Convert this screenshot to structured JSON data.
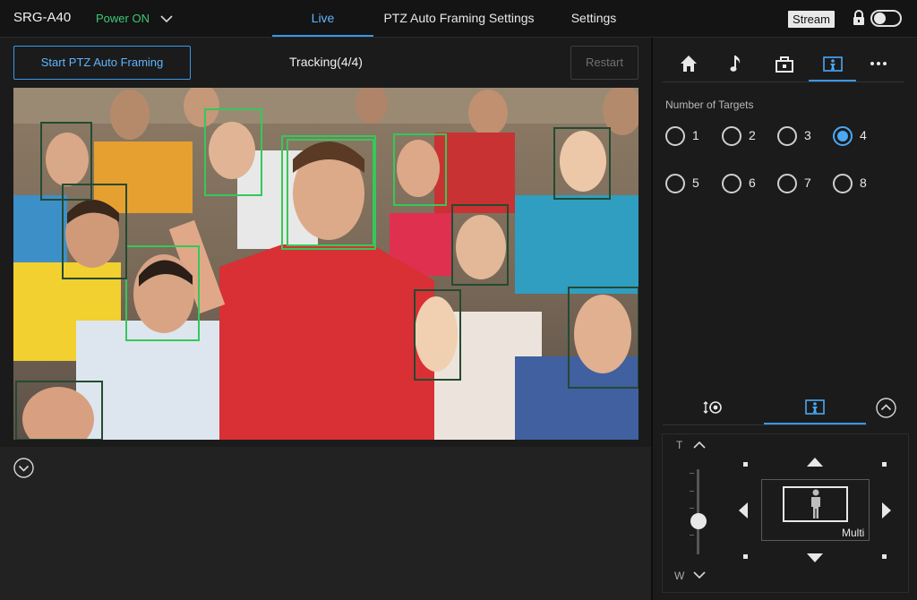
{
  "header": {
    "model": "SRG-A40",
    "power": "Power ON",
    "tabs": [
      {
        "label": "Live",
        "active": true
      },
      {
        "label": "PTZ Auto Framing Settings",
        "active": false
      },
      {
        "label": "Settings",
        "active": false
      }
    ],
    "stream_label": "Stream",
    "lock_toggle_on": false
  },
  "live": {
    "start_button": "Start PTZ Auto Framing",
    "tracking_status": "Tracking(4/4)",
    "restart_button": "Restart"
  },
  "right_panel": {
    "top_icons": [
      "home-icon",
      "music-note-icon",
      "camera-mount-icon",
      "framing-person-icon",
      "more-icon"
    ],
    "active_icon": "framing-person-icon",
    "targets_label": "Number of Targets",
    "target_options": [
      "1",
      "2",
      "3",
      "4",
      "5",
      "6",
      "7",
      "8"
    ],
    "selected_target": "4",
    "bottom_icons": [
      "ptz-joystick-icon",
      "framing-person-icon"
    ],
    "active_bottom_icon": "framing-person-icon",
    "zoom_tele_label": "T",
    "zoom_wide_label": "W",
    "frame_mode_label": "Multi"
  },
  "colors": {
    "accent": "#3a98e8",
    "power_green": "#3ec878",
    "face_box_tracked": "#35c85a",
    "face_box_detected": "#1e4a2e"
  }
}
